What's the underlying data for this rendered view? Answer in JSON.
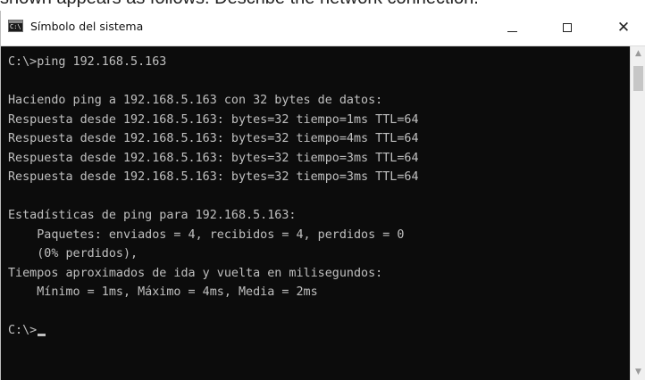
{
  "page": {
    "top_text": "shown appears as follows. Describe the network connection."
  },
  "window": {
    "title": "Símbolo del sistema",
    "icon_text": "C:\\",
    "buttons": {
      "minimize": "—",
      "maximize": "□",
      "close": "✕"
    }
  },
  "console": {
    "lines": [
      "C:\\>ping 192.168.5.163",
      "",
      "Haciendo ping a 192.168.5.163 con 32 bytes de datos:",
      "Respuesta desde 192.168.5.163: bytes=32 tiempo=1ms TTL=64",
      "Respuesta desde 192.168.5.163: bytes=32 tiempo=4ms TTL=64",
      "Respuesta desde 192.168.5.163: bytes=32 tiempo=3ms TTL=64",
      "Respuesta desde 192.168.5.163: bytes=32 tiempo=3ms TTL=64",
      "",
      "Estadísticas de ping para 192.168.5.163:",
      "    Paquetes: enviados = 4, recibidos = 4, perdidos = 0",
      "    (0% perdidos),",
      "Tiempos aproximados de ida y vuelta en milisegundos:",
      "    Mínimo = 1ms, Máximo = 4ms, Media = 2ms",
      ""
    ],
    "prompt": "C:\\>"
  },
  "scrollbar": {
    "up_arrow": "▲",
    "down_arrow": "▼",
    "up_icon_name": "chevron-up-icon",
    "down_icon_name": "chevron-down-icon"
  }
}
